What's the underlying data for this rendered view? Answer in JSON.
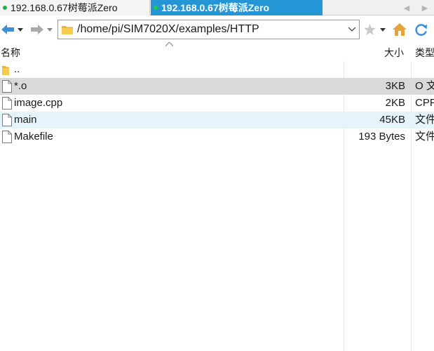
{
  "tabs": [
    {
      "label": "192.168.0.67树莓派Zero",
      "active": false
    },
    {
      "label": "192.168.0.67树莓派Zero",
      "active": true
    }
  ],
  "toolbar": {
    "back_icon": "arrow-left-icon",
    "forward_icon": "arrow-right-icon",
    "address": "/home/pi/SIM7020X/examples/HTTP",
    "bookmark_icon": "star-icon",
    "home_icon": "home-icon",
    "refresh_icon": "refresh-icon"
  },
  "columns": {
    "name": "名称",
    "size": "大小",
    "type": "类型"
  },
  "files": [
    {
      "name": "..",
      "size": "",
      "type": "",
      "kind": "folder",
      "state": ""
    },
    {
      "name": "*.o",
      "size": "3KB",
      "type": "O 文件",
      "kind": "file",
      "state": "selected"
    },
    {
      "name": "image.cpp",
      "size": "2KB",
      "type": "CPP 文件",
      "kind": "file",
      "state": ""
    },
    {
      "name": "main",
      "size": "45KB",
      "type": "文件",
      "kind": "file",
      "state": "hover"
    },
    {
      "name": "Makefile",
      "size": "193 Bytes",
      "type": "文件",
      "kind": "file",
      "state": ""
    }
  ],
  "colors": {
    "accent": "#2496d6",
    "status_dot": "#22b14c",
    "selected_row": "#d9d9d9",
    "hover_row": "#e5f3fb"
  }
}
